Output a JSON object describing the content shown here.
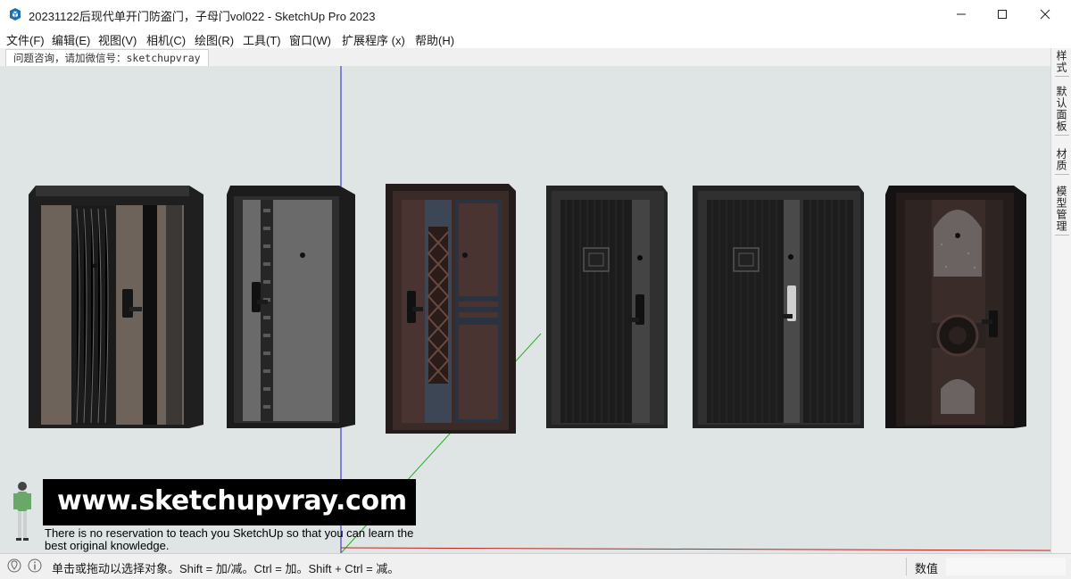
{
  "window": {
    "title": "20231122后现代单开门防盗门，子母门vol022 - SketchUp Pro 2023",
    "app_icon": "sketchup-logo-icon",
    "controls": [
      "minimize-icon",
      "maximize-icon",
      "close-icon"
    ]
  },
  "menu": {
    "items": [
      {
        "label": "文件(F)"
      },
      {
        "label": "编辑(E)"
      },
      {
        "label": "视图(V)"
      },
      {
        "label": "相机(C)"
      },
      {
        "label": "绘图(R)"
      },
      {
        "label": "工具(T)"
      },
      {
        "label": "窗口(W)"
      },
      {
        "label": "扩展程序 (x)"
      },
      {
        "label": "帮助(H)"
      }
    ]
  },
  "scene_tab": {
    "label": "问题咨询，请加微信号：sketchupvray"
  },
  "right_panel": {
    "tabs": [
      {
        "label": "样式"
      },
      {
        "label": "默认面板"
      },
      {
        "label": "材质"
      },
      {
        "label": "模型管理"
      }
    ]
  },
  "viewport": {
    "background": "#dfe4e4",
    "axis_colors": {
      "blue": "#2020d0",
      "green": "#22b022",
      "red": "#c02020"
    },
    "doors": [
      {
        "name": "door-1",
        "style": "wood-with-black-panel",
        "frame": "#2a2a2a",
        "leaf": "#6b5e56"
      },
      {
        "name": "door-2",
        "style": "grey-with-pattern-strip",
        "frame": "#2b2b2b",
        "leaf": "#5a5a5a"
      },
      {
        "name": "door-3",
        "style": "brown-lattice",
        "frame": "#2e2624",
        "leaf": "#4a3432"
      },
      {
        "name": "door-4",
        "style": "black-fluted-square",
        "frame": "#262626",
        "leaf": "#1c1c1c"
      },
      {
        "name": "door-5",
        "style": "black-fluted-square-double",
        "frame": "#262626",
        "leaf": "#1d1d1d"
      },
      {
        "name": "door-6",
        "style": "arched-glass",
        "frame": "#1e1a1a",
        "leaf": "#2e2422"
      }
    ]
  },
  "watermark": {
    "url": "www.sketchupvray.com",
    "caption": "There is no reservation to teach you SketchUp so that you can learn the best original knowledge."
  },
  "status": {
    "hint": "单击或拖动以选择对象。Shift = 加/减。Ctrl = 加。Shift + Ctrl = 减。",
    "measurement_label": "数值",
    "measurement_value": "",
    "icons": [
      "geo-location-icon",
      "info-icon"
    ]
  }
}
